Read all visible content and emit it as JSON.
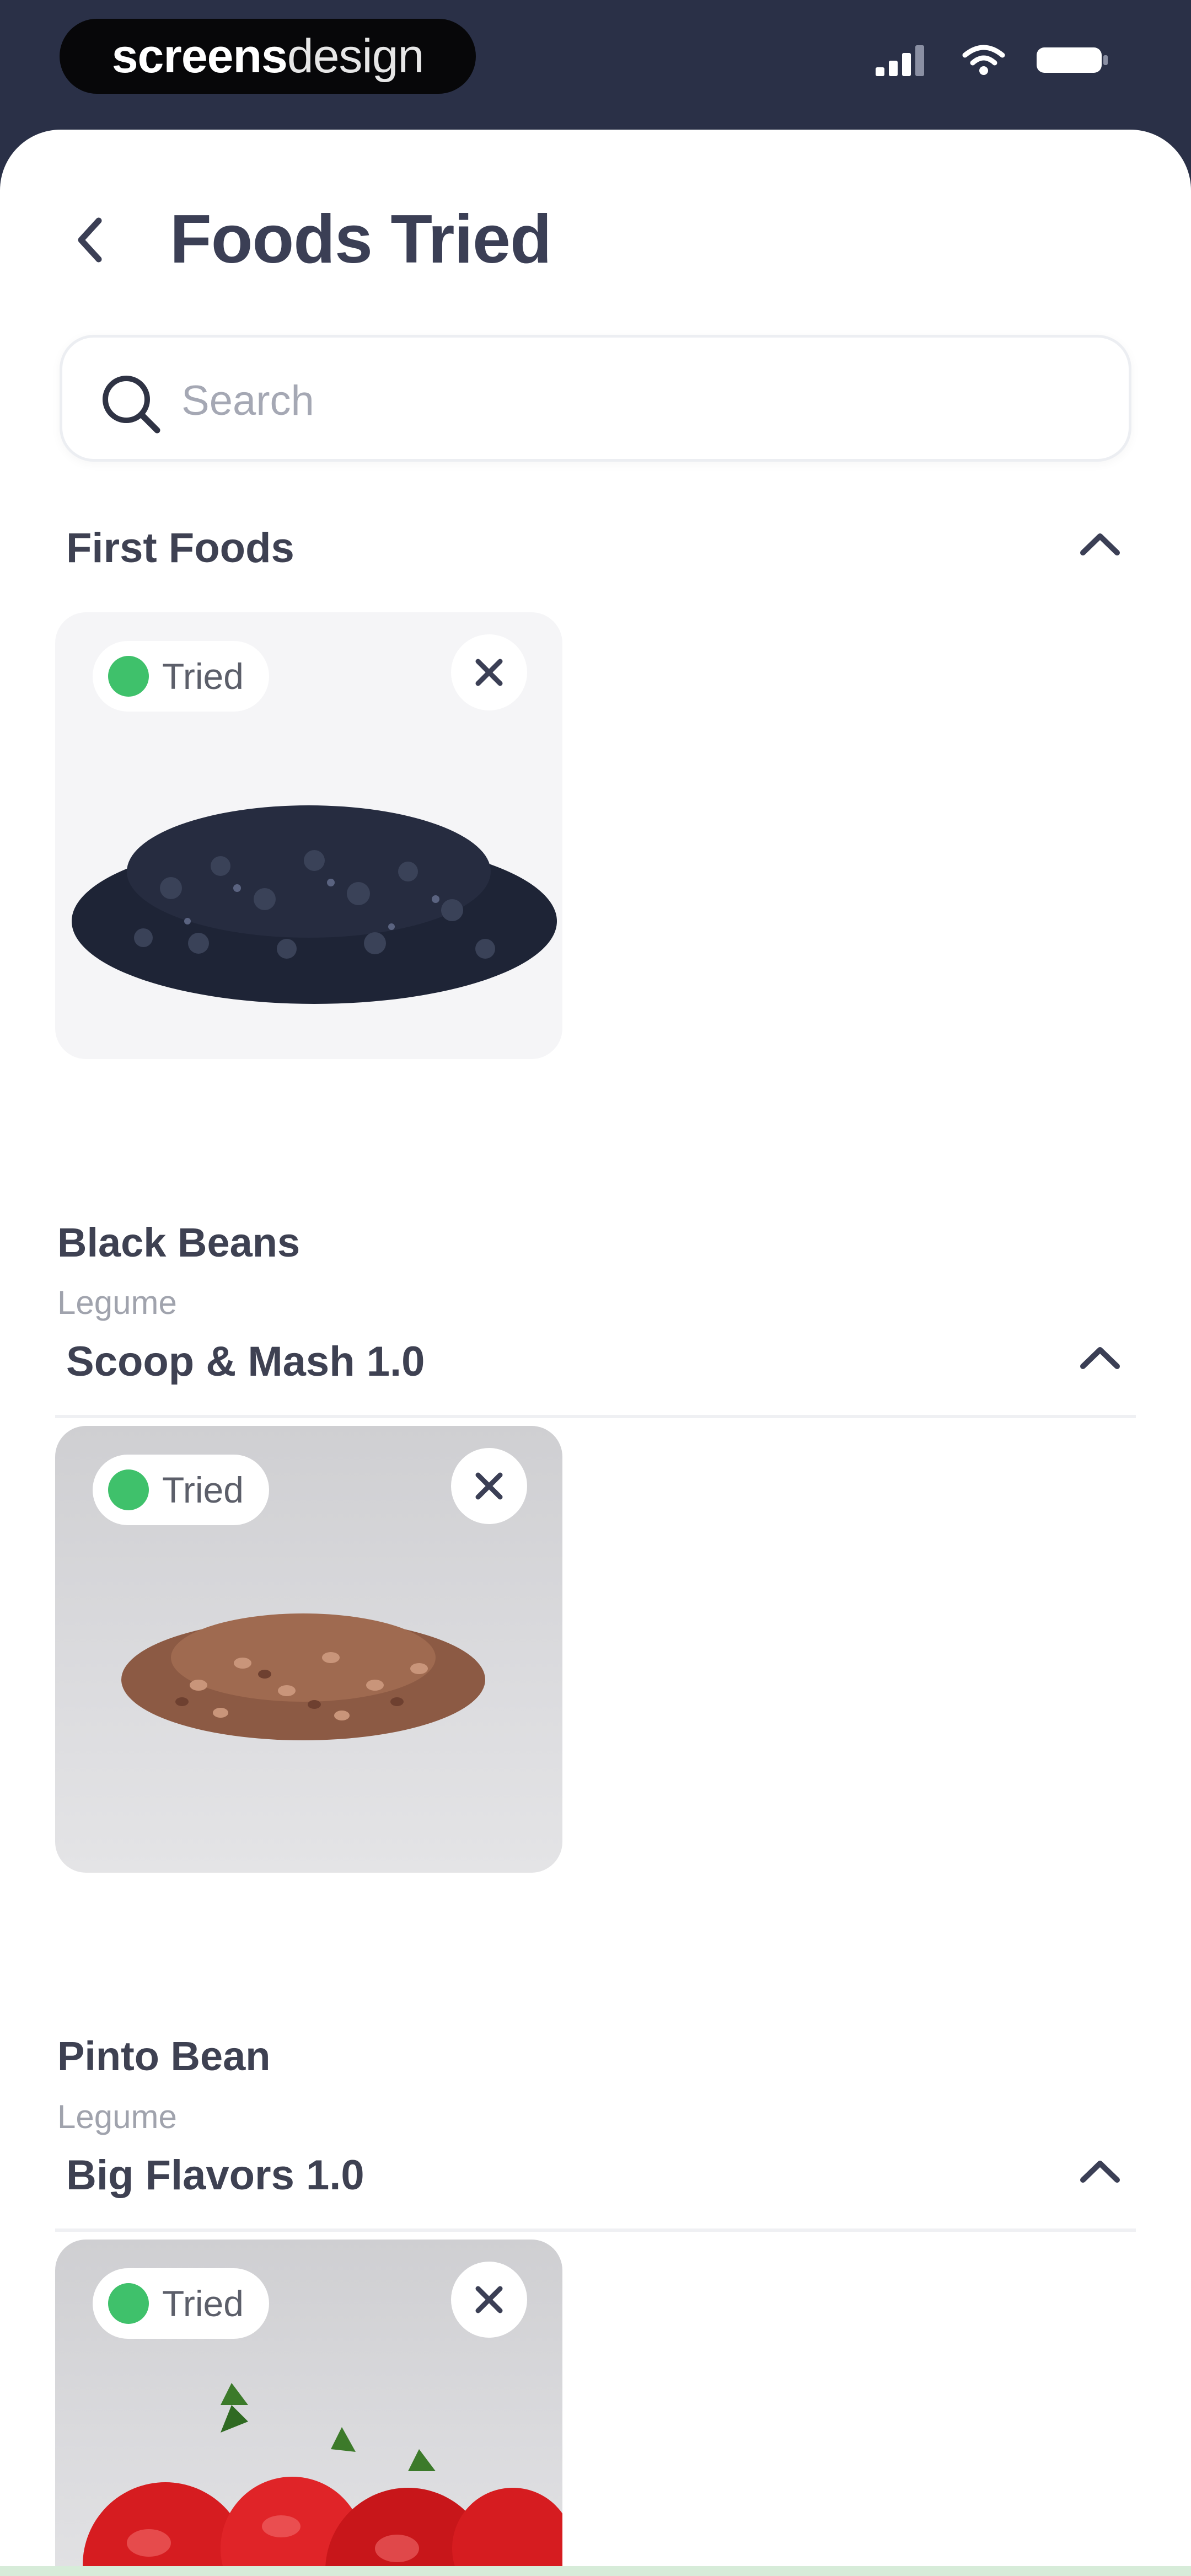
{
  "status_bar": {
    "brand_bold": "screens",
    "brand_light": "design",
    "icons": [
      "signal-icon",
      "wifi-icon",
      "battery-icon"
    ]
  },
  "header": {
    "title": "Foods Tried",
    "back_icon": "chevron-left-icon"
  },
  "search": {
    "placeholder": "Search",
    "value": ""
  },
  "sections": [
    {
      "title": "First Foods",
      "expanded": true,
      "items": [
        {
          "name": "Black Beans",
          "category": "Legume",
          "status": "Tried"
        }
      ]
    },
    {
      "title": "Scoop & Mash 1.0",
      "expanded": true,
      "items": [
        {
          "name": "Pinto Bean",
          "category": "Legume",
          "status": "Tried"
        }
      ]
    },
    {
      "title": "Big Flavors 1.0",
      "expanded": true,
      "items": [
        {
          "status": "Tried"
        }
      ]
    }
  ],
  "colors": {
    "status_bar_bg": "#2a3047",
    "tried_green": "#3fc16b",
    "title_text": "#3b3f55"
  }
}
